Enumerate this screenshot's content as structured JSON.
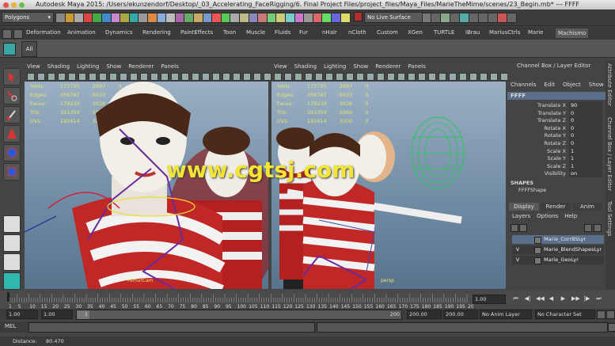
{
  "window": {
    "title": "Autodesk Maya 2015: /Users/ekunzendorf/Desktop/_03_Accelerating_FaceRigging/6. Final Project Files/project_files/Maya_Files/MarieTheMime/scenes/23_Begin.mb*  ---  FFFF"
  },
  "statusline": {
    "menu_set": "Polygons",
    "live_surface": "No Live Surface"
  },
  "shelf": {
    "tabs": [
      "Deformation",
      "Animation",
      "Dynamics",
      "Rendering",
      "PaintEffects",
      "Toon",
      "Muscle",
      "Fluids",
      "Fur",
      "nHair",
      "nCloth",
      "Custom",
      "XGen",
      "TURTLE",
      "iBrau",
      "MariusCtrls",
      "Marie",
      "Machismo"
    ],
    "active_tab": "Machismo",
    "button_label": "All"
  },
  "viewport_menu": [
    "View",
    "Shading",
    "Lighting",
    "Show",
    "Renderer",
    "Panels"
  ],
  "hud": {
    "labels": [
      "Verts:",
      "Edges:",
      "Faces:",
      "Tris:",
      "UVs:"
    ],
    "left": [
      [
        "177755",
        "2997",
        "0"
      ],
      [
        "356787",
        "6033",
        "0"
      ],
      [
        "179230",
        "3036",
        "0"
      ],
      [
        "351350",
        "5960",
        "0"
      ],
      [
        "192414",
        "3200",
        "0"
      ]
    ],
    "right": [
      [
        "177755",
        "2997",
        "0"
      ],
      [
        "356787",
        "6033",
        "0"
      ],
      [
        "179230",
        "3036",
        "0"
      ],
      [
        "351350",
        "5960",
        "0"
      ],
      [
        "192414",
        "3200",
        "0"
      ]
    ]
  },
  "viewport_labels": {
    "left_cam": "FemurCam",
    "right_cam": "persp"
  },
  "watermark": "www.cgtsj.com",
  "channel_box": {
    "header": "Channel Box / Layer Editor",
    "menu": [
      "Channels",
      "Edit",
      "Object",
      "Show"
    ],
    "object": "FFFF",
    "channels": [
      {
        "name": "Translate X",
        "value": "90"
      },
      {
        "name": "Translate Y",
        "value": "0"
      },
      {
        "name": "Translate Z",
        "value": "0"
      },
      {
        "name": "Rotate X",
        "value": "0"
      },
      {
        "name": "Rotate Y",
        "value": "0"
      },
      {
        "name": "Rotate Z",
        "value": "0"
      },
      {
        "name": "Scale X",
        "value": "1"
      },
      {
        "name": "Scale Y",
        "value": "1"
      },
      {
        "name": "Scale Z",
        "value": "1"
      },
      {
        "name": "Visibility",
        "value": "on"
      }
    ],
    "shapes_label": "SHAPES",
    "shape_name": "FFFFShape"
  },
  "layer_editor": {
    "tabs": [
      "Display",
      "Render",
      "Anim"
    ],
    "menu": [
      "Layers",
      "Options",
      "Help"
    ],
    "layers": [
      {
        "vis": "",
        "name": "Marie_CorrBSLyr"
      },
      {
        "vis": "V",
        "name": "Marie_BlendShapesLyr"
      },
      {
        "vis": "V",
        "name": "Marie_GeoLyr"
      }
    ]
  },
  "right_strip": [
    "Attribute Editor",
    "Channel Box / Layer Editor",
    "Tool Settings"
  ],
  "timeline": {
    "ticks": [
      "1",
      "5",
      "10",
      "15",
      "20",
      "25",
      "30",
      "35",
      "40",
      "45",
      "50",
      "55",
      "60",
      "65",
      "70",
      "75",
      "80",
      "85",
      "90",
      "95",
      "100",
      "105",
      "110",
      "115",
      "120",
      "125",
      "130",
      "135",
      "140",
      "145",
      "150",
      "155",
      "160",
      "165",
      "170",
      "175",
      "180",
      "185",
      "190",
      "195",
      "200"
    ],
    "current_frame": "1.00"
  },
  "range": {
    "start": "1.00",
    "inner_start": "1.00",
    "handle": "1",
    "inner_end": "200",
    "end": "200.00",
    "anim_end": "200.00",
    "anim_layer": "No Anim Layer",
    "character_set": "No Character Set"
  },
  "command_line": {
    "label": "MEL"
  },
  "help_line": {
    "label": "Distance:",
    "value": "80.470"
  }
}
